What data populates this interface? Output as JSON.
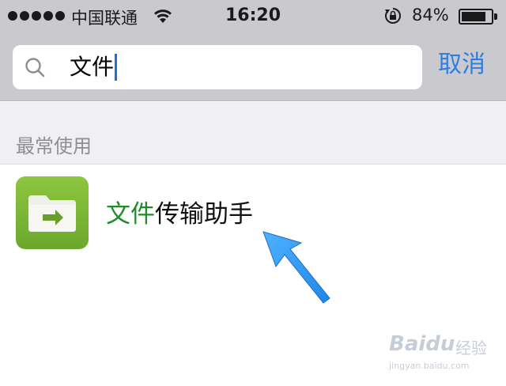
{
  "status_bar": {
    "carrier": "中国联通",
    "time": "16:20",
    "battery_percent": "84%",
    "battery_level": 0.84,
    "icons": [
      "signal-dots-icon",
      "wifi-icon",
      "rotation-lock-icon",
      "battery-icon"
    ]
  },
  "search": {
    "query": "文件",
    "cancel_label": "取消"
  },
  "section": {
    "title": "最常使用"
  },
  "results": [
    {
      "highlight": "文件",
      "rest": "传输助手",
      "icon": "file-transfer-folder-icon"
    }
  ],
  "colors": {
    "header_bg": "#c9c9ce",
    "accent_blue": "#2e7fe0",
    "highlight_green": "#1e8c2b",
    "app_icon_green": "#7ab536",
    "arrow_blue": "#2b96f0"
  },
  "watermark": {
    "logo": "Baidu",
    "logo_cn": "经验",
    "url": "jingyan.baidu.com"
  }
}
